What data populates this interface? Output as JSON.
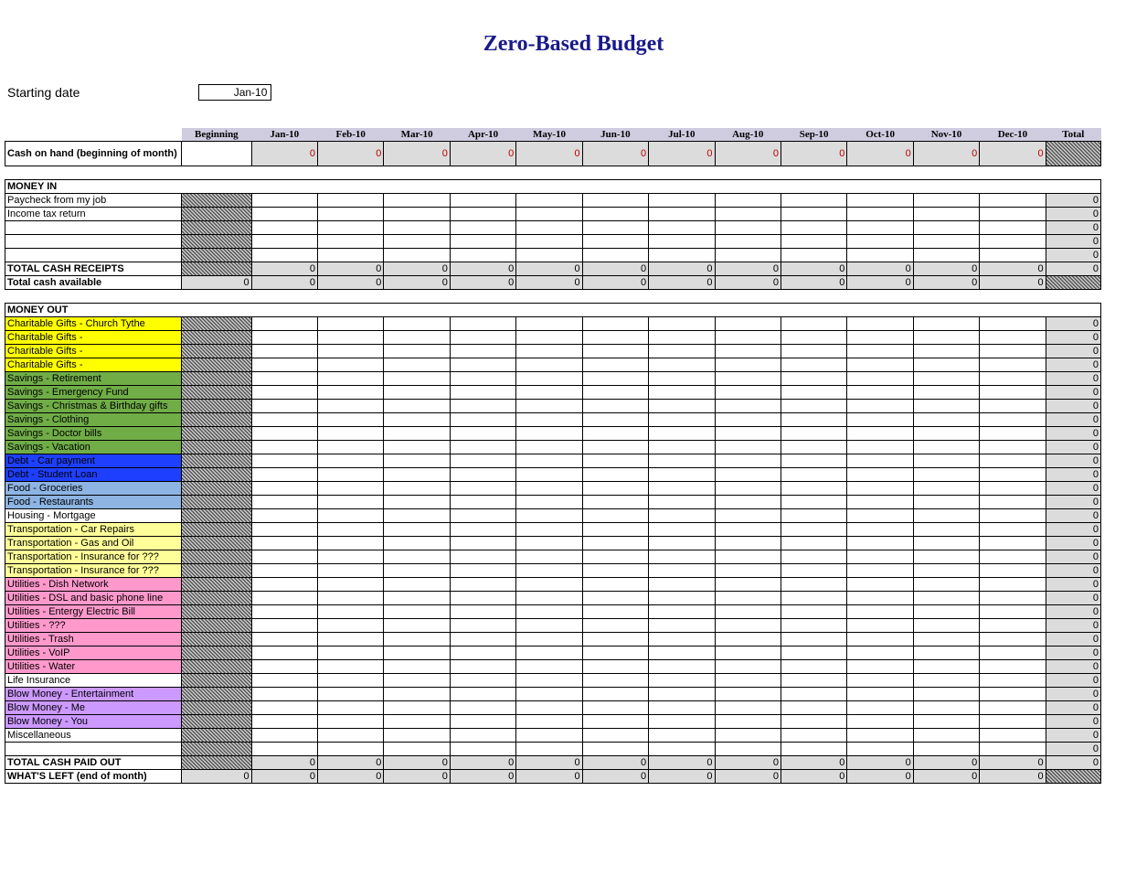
{
  "title": "Zero-Based Budget",
  "starting_date_label": "Starting date",
  "starting_date_value": "Jan-10",
  "columns": [
    "Beginning",
    "Jan-10",
    "Feb-10",
    "Mar-10",
    "Apr-10",
    "May-10",
    "Jun-10",
    "Jul-10",
    "Aug-10",
    "Sep-10",
    "Oct-10",
    "Nov-10",
    "Dec-10",
    "Total"
  ],
  "cash_on_hand_label": "Cash on hand (beginning of month)",
  "cash_on_hand_values": [
    "",
    "0",
    "0",
    "0",
    "0",
    "0",
    "0",
    "0",
    "0",
    "0",
    "0",
    "0",
    "0",
    ""
  ],
  "section_money_in": "MONEY IN",
  "money_in_rows": [
    {
      "label": "Paycheck from my job",
      "total": "0"
    },
    {
      "label": "Income tax return",
      "total": "0"
    },
    {
      "label": "",
      "total": "0"
    },
    {
      "label": "",
      "total": "0"
    },
    {
      "label": "",
      "total": "0"
    }
  ],
  "total_cash_receipts_label": "TOTAL CASH RECEIPTS",
  "total_cash_receipts_values": [
    "",
    "0",
    "0",
    "0",
    "0",
    "0",
    "0",
    "0",
    "0",
    "0",
    "0",
    "0",
    "0",
    "0"
  ],
  "total_cash_available_label": "Total cash available",
  "total_cash_available_values": [
    "0",
    "0",
    "0",
    "0",
    "0",
    "0",
    "0",
    "0",
    "0",
    "0",
    "0",
    "0",
    "0",
    ""
  ],
  "section_money_out": "MONEY OUT",
  "money_out_rows": [
    {
      "label": "Charitable Gifts - Church Tythe",
      "color": "#ffff00",
      "total": "0"
    },
    {
      "label": "Charitable Gifts -",
      "color": "#ffff00",
      "total": "0"
    },
    {
      "label": "Charitable Gifts -",
      "color": "#ffff00",
      "total": "0"
    },
    {
      "label": "Charitable Gifts -",
      "color": "#ffff00",
      "total": "0"
    },
    {
      "label": "Savings - Retirement",
      "color": "#70ad47",
      "total": "0"
    },
    {
      "label": "Savings - Emergency Fund",
      "color": "#70ad47",
      "total": "0"
    },
    {
      "label": "Savings - Christmas & Birthday gifts",
      "color": "#70ad47",
      "total": "0"
    },
    {
      "label": "Savings - Clothing",
      "color": "#70ad47",
      "total": "0"
    },
    {
      "label": "Savings - Doctor bills",
      "color": "#70ad47",
      "total": "0"
    },
    {
      "label": "Savings - Vacation",
      "color": "#70ad47",
      "total": "0"
    },
    {
      "label": "Debt - Car payment",
      "color": "#1f3fff",
      "total": "0"
    },
    {
      "label": "Debt - Student Loan",
      "color": "#1f3fff",
      "total": "0"
    },
    {
      "label": "Food - Groceries",
      "color": "#8db4e2",
      "total": "0"
    },
    {
      "label": "Food - Restaurants",
      "color": "#8db4e2",
      "total": "0"
    },
    {
      "label": "Housing - Mortgage",
      "color": "",
      "total": "0"
    },
    {
      "label": "Transportation - Car Repairs",
      "color": "#ffff99",
      "total": "0"
    },
    {
      "label": "Transportation - Gas and Oil",
      "color": "#ffff99",
      "total": "0"
    },
    {
      "label": "Transportation - Insurance for ???",
      "color": "#ffff99",
      "total": "0"
    },
    {
      "label": "Transportation - Insurance for ???",
      "color": "#ffff99",
      "total": "0"
    },
    {
      "label": "Utilities - Dish Network",
      "color": "#ff99cc",
      "total": "0"
    },
    {
      "label": "Utilities - DSL and basic phone line",
      "color": "#ff99cc",
      "total": "0"
    },
    {
      "label": "Utilities - Entergy Electric Bill",
      "color": "#ff99cc",
      "total": "0"
    },
    {
      "label": "Utilities - ???",
      "color": "#ff99cc",
      "total": "0"
    },
    {
      "label": "Utilities - Trash",
      "color": "#ff99cc",
      "total": "0"
    },
    {
      "label": "Utilities - VoIP",
      "color": "#ff99cc",
      "total": "0"
    },
    {
      "label": "Utilities - Water",
      "color": "#ff99cc",
      "total": "0"
    },
    {
      "label": "Life Insurance",
      "color": "",
      "total": "0"
    },
    {
      "label": "Blow Money - Entertainment",
      "color": "#cc99ff",
      "total": "0"
    },
    {
      "label": "Blow Money - Me",
      "color": "#cc99ff",
      "total": "0"
    },
    {
      "label": "Blow Money - You",
      "color": "#cc99ff",
      "total": "0"
    },
    {
      "label": "Miscellaneous",
      "color": "",
      "total": "0"
    },
    {
      "label": "",
      "color": "",
      "total": "0"
    }
  ],
  "total_cash_paid_out_label": "TOTAL CASH PAID OUT",
  "total_cash_paid_out_values": [
    "",
    "0",
    "0",
    "0",
    "0",
    "0",
    "0",
    "0",
    "0",
    "0",
    "0",
    "0",
    "0",
    "0"
  ],
  "whats_left_label": "WHAT'S LEFT (end of month)",
  "whats_left_values": [
    "0",
    "0",
    "0",
    "0",
    "0",
    "0",
    "0",
    "0",
    "0",
    "0",
    "0",
    "0",
    "0",
    ""
  ]
}
